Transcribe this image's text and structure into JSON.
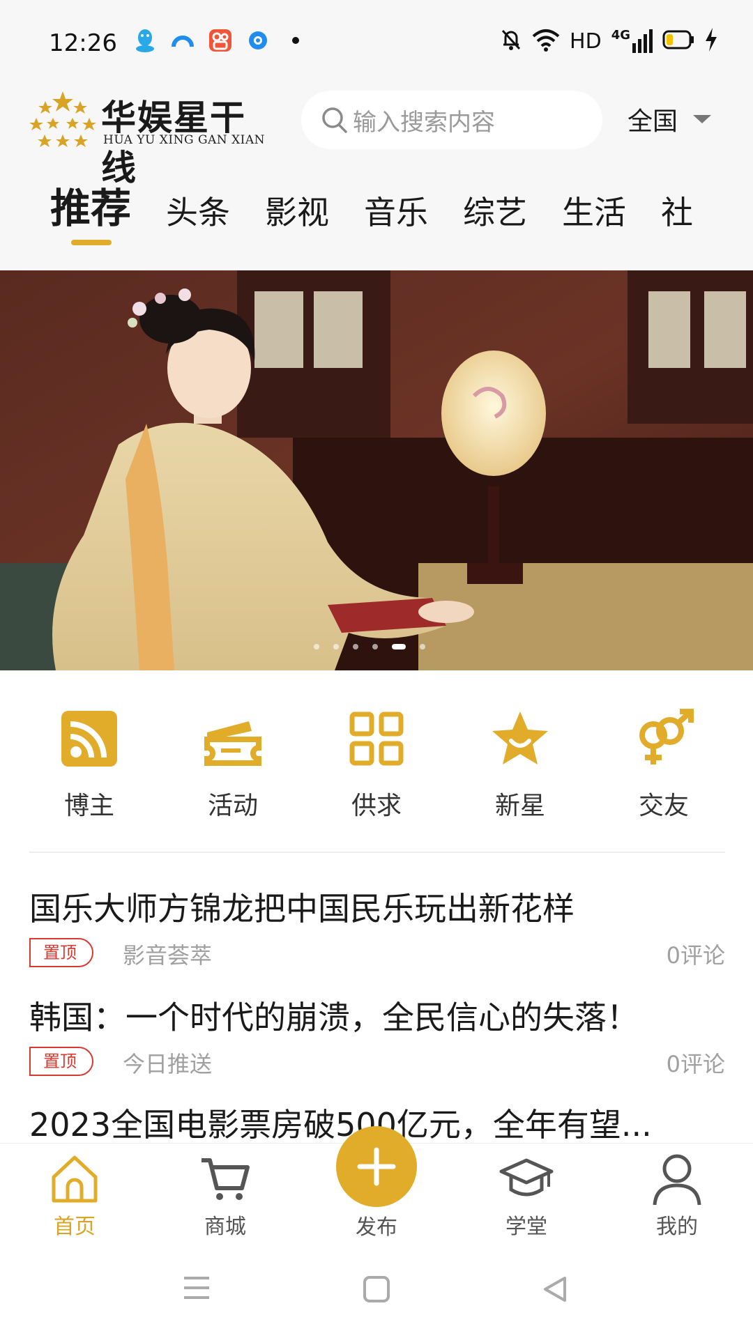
{
  "status_bar": {
    "time": "12:26",
    "left_icons": [
      "qq-icon",
      "browser-icon",
      "kuaishou-icon",
      "app-icon",
      "notification-dot-icon"
    ],
    "right_icons": [
      "mute-bell-icon",
      "wifi-icon",
      "signal-icon",
      "battery-icon",
      "charging-icon"
    ],
    "hd_label": "HD",
    "network_label": "4G",
    "battery_level": 0.3
  },
  "header": {
    "logo_title": "华娱星干线",
    "logo_subtitle": "HUA YU XING GAN XIAN",
    "search_placeholder": "输入搜索内容",
    "region": "全国"
  },
  "tabs": [
    {
      "label": "推荐",
      "active": true
    },
    {
      "label": "头条",
      "active": false
    },
    {
      "label": "影视",
      "active": false
    },
    {
      "label": "音乐",
      "active": false
    },
    {
      "label": "综艺",
      "active": false
    },
    {
      "label": "生活",
      "active": false
    },
    {
      "label": "社",
      "active": false
    }
  ],
  "banner": {
    "slide_count": 6,
    "active_index": 4
  },
  "quick_links": [
    {
      "label": "博主",
      "icon": "rss-icon"
    },
    {
      "label": "活动",
      "icon": "ticket-icon"
    },
    {
      "label": "供求",
      "icon": "grid-icon"
    },
    {
      "label": "新星",
      "icon": "star-icon"
    },
    {
      "label": "交友",
      "icon": "gender-icon"
    }
  ],
  "news": [
    {
      "title": "国乐大师方锦龙把中国民乐玩出新花样",
      "tag": "置顶",
      "source": "影音荟萃",
      "comments": "0评论"
    },
    {
      "title": "韩国：一个时代的崩溃，全民信心的失落！",
      "tag": "置顶",
      "source": "今日推送",
      "comments": "0评论"
    },
    {
      "title": "2023全国电影票房破500亿元，全年有望..."
    }
  ],
  "bottom_nav": [
    {
      "label": "首页",
      "icon": "home-icon",
      "active": true
    },
    {
      "label": "商城",
      "icon": "cart-icon",
      "active": false
    },
    {
      "label": "发布",
      "icon": "plus-icon",
      "active": false
    },
    {
      "label": "学堂",
      "icon": "graduation-cap-icon",
      "active": false
    },
    {
      "label": "我的",
      "icon": "user-icon",
      "active": false
    }
  ],
  "colors": {
    "accent": "#e0ac2a",
    "pin_red": "#d9382f",
    "muted_text": "#a0a0a0"
  }
}
